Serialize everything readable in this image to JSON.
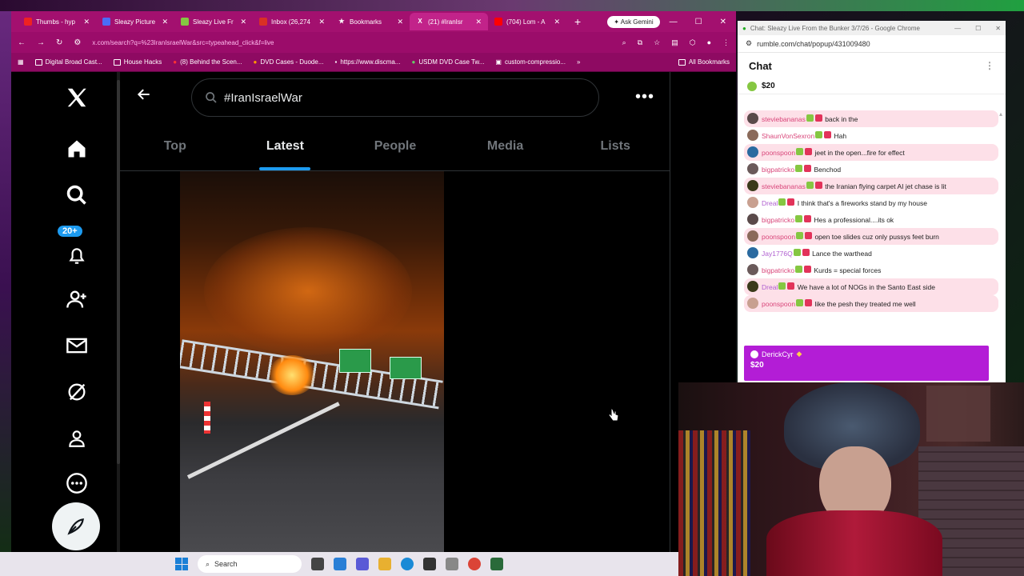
{
  "browser": {
    "tabs": [
      {
        "label": "Thumbs - hyp",
        "color": "#e22"
      },
      {
        "label": "Sleazy Picture",
        "color": "#4a6cf7"
      },
      {
        "label": "Sleazy Live Fr",
        "color": "#85c742"
      },
      {
        "label": "Inbox (26,274",
        "color": "#d93025"
      },
      {
        "label": "Bookmarks",
        "color": "#ffffff"
      },
      {
        "label": "(21) #IranIsr",
        "color": "#000000"
      },
      {
        "label": "(704) Lom - A",
        "color": "#ff0000"
      }
    ],
    "active_tab": 5,
    "new_tab": "+",
    "gemini_label": "Ask Gemini",
    "url": "x.com/search?q=%23IranIsraelWar&src=typeahead_click&f=live",
    "bookmarks": [
      "Digital Broad Cast...",
      "House Hacks",
      "(8) Behind the Scen...",
      "DVD Cases - Duode...",
      "https://www.discma...",
      "USDM DVD Case Tw...",
      "custom-compressio..."
    ],
    "all_bookmarks": "All Bookmarks"
  },
  "x": {
    "search_query": "#IranIsraelWar",
    "tabs": [
      "Top",
      "Latest",
      "People",
      "Media",
      "Lists"
    ],
    "active_tab": "Latest",
    "notification_count": "20+"
  },
  "taskbar": {
    "search_label": "Search"
  },
  "chat": {
    "window_title": "Chat: Sleazy Live From the Bunker 3/7/26 - Google Chrome",
    "url": "rumble.com/chat/popup/431009480",
    "header": "Chat",
    "pinned_amount": "$20",
    "messages": [
      {
        "user": "steviebananas",
        "text": "back in the",
        "user_color": "#d9467a",
        "hl": true
      },
      {
        "user": "ShaunVonSexron",
        "text": "Hah",
        "user_color": "#d9467a",
        "hl": false
      },
      {
        "user": "poonspoon",
        "text": "jeet in the open...fire for effect",
        "user_color": "#d9467a",
        "hl": true
      },
      {
        "user": "bigpatricko",
        "text": "Benchod",
        "user_color": "#d9467a",
        "hl": false
      },
      {
        "user": "steviebananas",
        "text": "the Iranian flying carpet AI jet chase is lit",
        "user_color": "#d9467a",
        "hl": true
      },
      {
        "user": "Dreal",
        "text": "I think that's a fireworks stand by my house",
        "user_color": "#b060d0",
        "hl": false
      },
      {
        "user": "bigpatricko",
        "text": "Hes a professional....its ok",
        "user_color": "#d9467a",
        "hl": false
      },
      {
        "user": "poonspoon",
        "text": "open toe slides cuz only pussys feet burn",
        "user_color": "#d9467a",
        "hl": true
      },
      {
        "user": "Jay1776Q",
        "text": "Lance the warthead",
        "user_color": "#b060d0",
        "hl": false
      },
      {
        "user": "bigpatricko",
        "text": "Kurds = special forces",
        "user_color": "#d9467a",
        "hl": false
      },
      {
        "user": "Dreal",
        "text": "We have a lot of NOGs in the Santo East side",
        "user_color": "#b060d0",
        "hl": true
      },
      {
        "user": "poonspoon",
        "text": "like the pesh they treated me well",
        "user_color": "#d9467a",
        "hl": true
      }
    ],
    "rant": {
      "user": "DerickCyr",
      "amount": "$20"
    }
  }
}
